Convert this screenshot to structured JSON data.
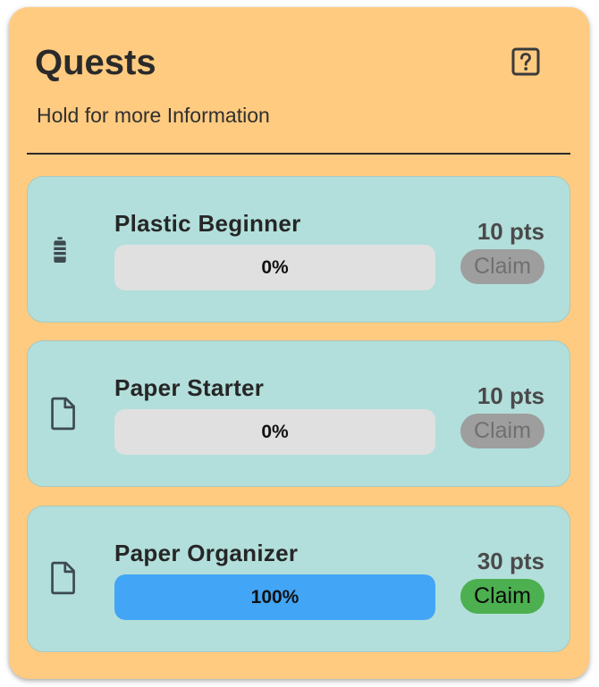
{
  "header": {
    "title": "Quests",
    "subtitle": "Hold for more Information",
    "help_icon": "help-question-box-icon"
  },
  "colors": {
    "panel_bg": "#FFCB80",
    "card_bg": "#B2DFDB",
    "progress_track": "#E0E0E0",
    "progress_fill_complete": "#42A5F5",
    "claim_disabled_bg": "#9E9E9E",
    "claim_disabled_text": "#707070",
    "claim_enabled_bg": "#4CAF50",
    "claim_enabled_text": "#0a0a0a"
  },
  "quests": [
    {
      "name": "Plastic Beginner",
      "icon": "plastic-bottle-icon",
      "progress": 0,
      "progress_label": "0%",
      "points": "10 pts",
      "claim_label": "Claim",
      "claim_enabled": false
    },
    {
      "name": "Paper Starter",
      "icon": "paper-document-icon",
      "progress": 0,
      "progress_label": "0%",
      "points": "10 pts",
      "claim_label": "Claim",
      "claim_enabled": false
    },
    {
      "name": "Paper Organizer",
      "icon": "paper-document-icon",
      "progress": 1.0,
      "progress_label": "100%",
      "points": "30 pts",
      "claim_label": "Claim",
      "claim_enabled": true
    }
  ]
}
